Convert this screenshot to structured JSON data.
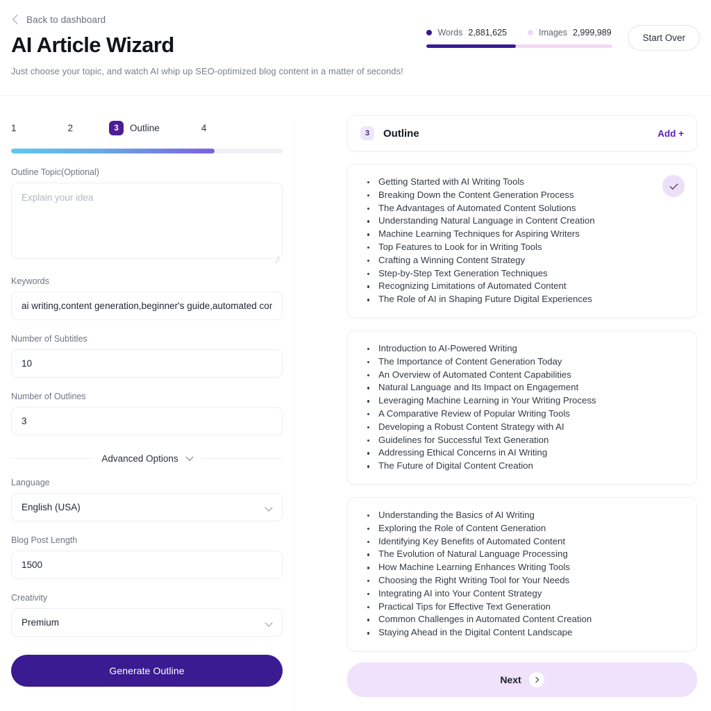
{
  "header": {
    "back_label": "Back to dashboard",
    "title": "AI Article Wizard",
    "subtitle": "Just choose your topic, and watch AI whip up SEO-optimized blog content in a matter of seconds!",
    "start_over_label": "Start Over",
    "usage": {
      "words_label": "Words",
      "words_value": "2,881,625",
      "images_label": "Images",
      "images_value": "2,999,989",
      "words_color": "#3a1b91",
      "images_color": "#ead9f7",
      "bar_fill_percent": 48
    }
  },
  "wizard": {
    "steps": [
      {
        "number": "1",
        "label": "",
        "active": false
      },
      {
        "number": "2",
        "label": "",
        "active": false
      },
      {
        "number": "3",
        "label": "Outline",
        "active": true
      },
      {
        "number": "4",
        "label": "",
        "active": false
      }
    ],
    "progress_percent": 75,
    "progress_gradient_from": "#5ec8f0",
    "progress_gradient_to": "#7b61e0"
  },
  "form": {
    "outline_topic": {
      "label": "Outline Topic(Optional)",
      "placeholder": "Explain your idea",
      "value": ""
    },
    "keywords": {
      "label": "Keywords",
      "value": "ai writing,content generation,beginner's guide,automated content,natural language,machine learning"
    },
    "number_of_subtitles": {
      "label": "Number of Subtitles",
      "value": "10"
    },
    "number_of_outlines": {
      "label": "Number of Outlines",
      "value": "3"
    },
    "advanced_options_label": "Advanced Options",
    "language": {
      "label": "Language",
      "value": "English (USA)"
    },
    "blog_post_length": {
      "label": "Blog Post Length",
      "value": "1500"
    },
    "creativity": {
      "label": "Creativity",
      "value": "Premium"
    },
    "generate_button_label": "Generate Outline"
  },
  "outline_panel": {
    "badge": "3",
    "title": "Outline",
    "add_label": "Add +",
    "next_label": "Next",
    "cards": [
      {
        "selected": true,
        "items": [
          "Getting Started with AI Writing Tools",
          "Breaking Down the Content Generation Process",
          "The Advantages of Automated Content Solutions",
          "Understanding Natural Language in Content Creation",
          "Machine Learning Techniques for Aspiring Writers",
          "Top Features to Look for in Writing Tools",
          "Crafting a Winning Content Strategy",
          "Step-by-Step Text Generation Techniques",
          "Recognizing Limitations of Automated Content",
          "The Role of AI in Shaping Future Digital Experiences"
        ]
      },
      {
        "selected": false,
        "items": [
          "Introduction to AI-Powered Writing",
          "The Importance of Content Generation Today",
          "An Overview of Automated Content Capabilities",
          "Natural Language and Its Impact on Engagement",
          "Leveraging Machine Learning in Your Writing Process",
          "A Comparative Review of Popular Writing Tools",
          "Developing a Robust Content Strategy with AI",
          "Guidelines for Successful Text Generation",
          "Addressing Ethical Concerns in AI Writing",
          "The Future of Digital Content Creation"
        ]
      },
      {
        "selected": false,
        "items": [
          "Understanding the Basics of AI Writing",
          "Exploring the Role of Content Generation",
          "Identifying Key Benefits of Automated Content",
          "The Evolution of Natural Language Processing",
          "How Machine Learning Enhances Writing Tools",
          "Choosing the Right Writing Tool for Your Needs",
          "Integrating AI into Your Content Strategy",
          "Practical Tips for Effective Text Generation",
          "Common Challenges in Automated Content Creation",
          "Staying Ahead in the Digital Content Landscape"
        ]
      }
    ]
  }
}
